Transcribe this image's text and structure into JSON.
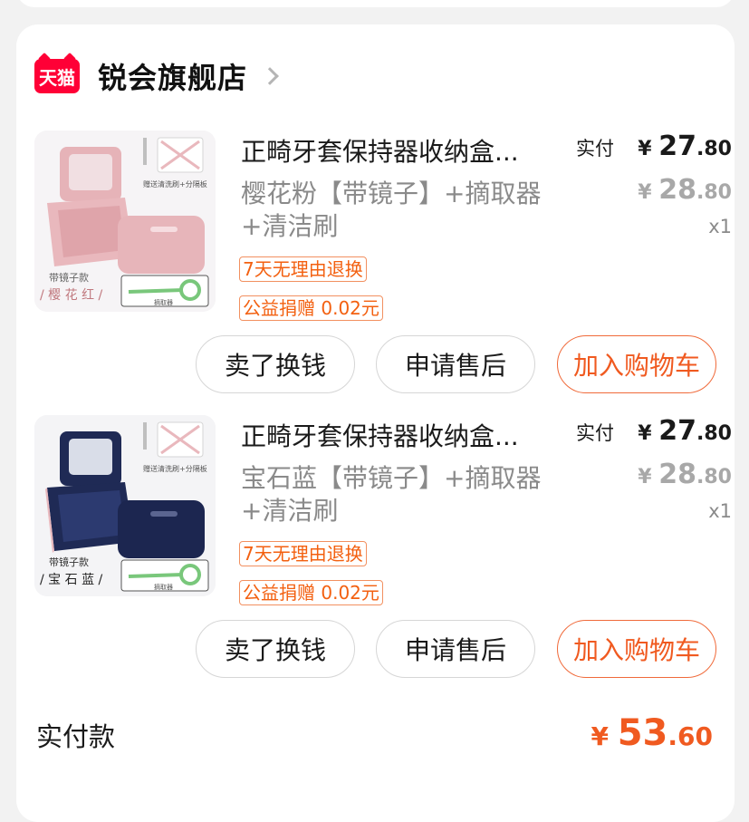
{
  "shop": {
    "logo_text": "天猫",
    "name": "锐会旗舰店"
  },
  "items": [
    {
      "title": "正畸牙套保持器收纳盒...",
      "variant": "樱花粉【带镜子】+摘取器+清洁刷",
      "thumb_caption_top": "带镜子款",
      "thumb_caption_bottom": "/ 樱 花 红 /",
      "thumb_promo": "赠送清洗刷+分隔板",
      "thumb_tool": "摘取器",
      "tags": [
        "7天无理由退换",
        "公益捐赠 0.02元"
      ],
      "paid_label": "实付",
      "currency": "¥",
      "paid_int": "27",
      "paid_dec": ".80",
      "orig_int": "28",
      "orig_dec": ".80",
      "qty": "x1",
      "buttons": [
        "卖了换钱",
        "申请售后",
        "加入购物车"
      ],
      "box_color": "#e9b8bd"
    },
    {
      "title": "正畸牙套保持器收纳盒...",
      "variant": "宝石蓝【带镜子】+摘取器+清洁刷",
      "thumb_caption_top": "带镜子款",
      "thumb_caption_bottom": "/ 宝 石 蓝 /",
      "thumb_promo": "赠送清洗刷+分隔板",
      "thumb_tool": "摘取器",
      "tags": [
        "7天无理由退换",
        "公益捐赠 0.02元"
      ],
      "paid_label": "实付",
      "currency": "¥",
      "paid_int": "27",
      "paid_dec": ".80",
      "orig_int": "28",
      "orig_dec": ".80",
      "qty": "x1",
      "buttons": [
        "卖了换钱",
        "申请售后",
        "加入购物车"
      ],
      "box_color": "#1f2a55"
    }
  ],
  "total": {
    "label": "实付款",
    "currency": "¥",
    "int": "53",
    "dec": ".60"
  },
  "colors": {
    "accent": "#f05a20",
    "tmall_red": "#ff0036"
  }
}
